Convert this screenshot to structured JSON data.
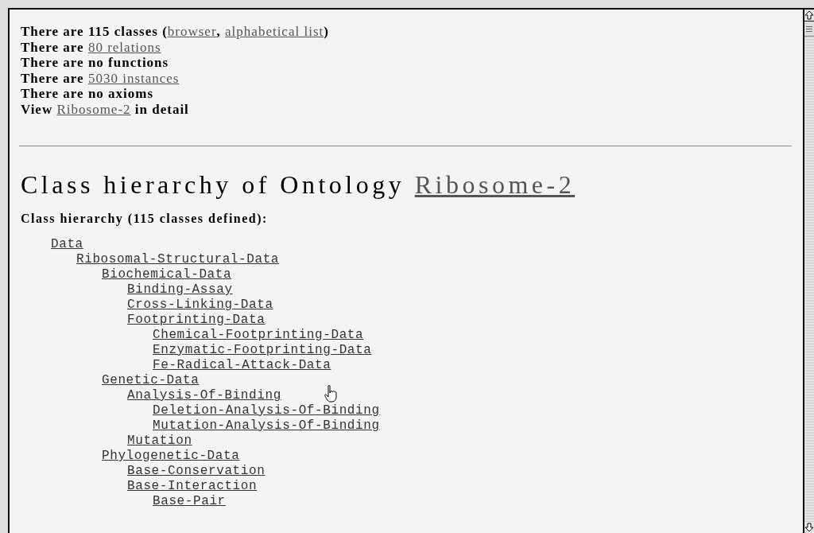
{
  "summary": [
    {
      "parts": [
        {
          "kind": "text",
          "text": "There are 115 classes ("
        },
        {
          "kind": "link",
          "text": "browser"
        },
        {
          "kind": "text",
          "text": ", "
        },
        {
          "kind": "link",
          "text": "alphabetical list"
        },
        {
          "kind": "text",
          "text": ")"
        }
      ]
    },
    {
      "parts": [
        {
          "kind": "text",
          "text": "There are "
        },
        {
          "kind": "link",
          "text": "80 relations"
        }
      ]
    },
    {
      "parts": [
        {
          "kind": "text",
          "text": "There are no functions"
        }
      ]
    },
    {
      "parts": [
        {
          "kind": "text",
          "text": "There are "
        },
        {
          "kind": "link",
          "text": "5030 instances"
        }
      ]
    },
    {
      "parts": [
        {
          "kind": "text",
          "text": "There are no axioms"
        }
      ]
    },
    {
      "parts": [
        {
          "kind": "text",
          "text": "View "
        },
        {
          "kind": "link",
          "text": "Ribosome-2"
        },
        {
          "kind": "text",
          "text": " in detail"
        }
      ]
    }
  ],
  "heading": {
    "text": "Class hierarchy of Ontology ",
    "link": "Ribosome-2"
  },
  "subheading": "Class hierarchy (115 classes defined):",
  "tree": [
    {
      "label": "Data",
      "children": [
        {
          "label": "Ribosomal-Structural-Data",
          "children": [
            {
              "label": "Biochemical-Data",
              "children": [
                {
                  "label": "Binding-Assay"
                },
                {
                  "label": "Cross-Linking-Data"
                },
                {
                  "label": "Footprinting-Data",
                  "children": [
                    {
                      "label": "Chemical-Footprinting-Data"
                    },
                    {
                      "label": "Enzymatic-Footprinting-Data"
                    },
                    {
                      "label": "Fe-Radical-Attack-Data"
                    }
                  ]
                }
              ]
            },
            {
              "label": "Genetic-Data",
              "children": [
                {
                  "label": "Analysis-Of-Binding",
                  "children": [
                    {
                      "label": "Deletion-Analysis-Of-Binding"
                    },
                    {
                      "label": "Mutation-Analysis-Of-Binding"
                    }
                  ]
                },
                {
                  "label": "Mutation"
                }
              ]
            },
            {
              "label": "Phylogenetic-Data",
              "children": [
                {
                  "label": "Base-Conservation"
                },
                {
                  "label": "Base-Interaction",
                  "children": [
                    {
                      "label": "Base-Pair"
                    }
                  ]
                }
              ]
            }
          ]
        }
      ]
    }
  ]
}
